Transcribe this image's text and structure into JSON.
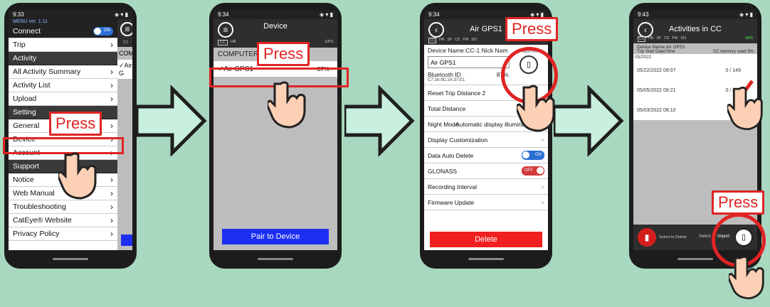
{
  "phone1": {
    "time": "9:33",
    "version": "MENU ver. 1.11",
    "connect_label": "Connect",
    "toggle_on": "ON",
    "items": [
      {
        "label": "Trip",
        "type": "item"
      },
      {
        "label": "Activity",
        "type": "section"
      },
      {
        "label": "All Activity Summary",
        "type": "item"
      },
      {
        "label": "Activity List",
        "type": "item"
      },
      {
        "label": "Upload",
        "type": "item"
      },
      {
        "label": "Setting",
        "type": "section"
      },
      {
        "label": "General",
        "type": "item"
      },
      {
        "label": "Device",
        "type": "item"
      },
      {
        "label": "Account",
        "type": "item"
      },
      {
        "label": "Support",
        "type": "section"
      },
      {
        "label": "Notice",
        "type": "item"
      },
      {
        "label": "Web Manual",
        "type": "item"
      },
      {
        "label": "Troubleshooting",
        "type": "item"
      },
      {
        "label": "CatEye® Website",
        "type": "item"
      },
      {
        "label": "Privacy Policy",
        "type": "item"
      }
    ],
    "side_comp": "COMP",
    "side_air": "✓Air G",
    "side_cc": "CC",
    "press": "Press"
  },
  "phone2": {
    "time": "9:34",
    "title": "Device",
    "computer_label": "COMPUTER",
    "device_name": "✓Air GPS1",
    "battery": "87%",
    "gps": "GPS",
    "pair_button": "Pair to Device",
    "press": "Press",
    "tabs": [
      "CC",
      "HR"
    ]
  },
  "phone3": {
    "time": "9:34",
    "title": "Air GPS1",
    "nickname_label": "Device Name:CC-1 Nick Nam",
    "name_value": "Air GPS1",
    "import_label": "Import from CC",
    "bluetooth_label": "Bluetooth ID",
    "bluetooth_id": "C7:3A:9C:2A:37:E1",
    "battery": "87%",
    "rows": [
      {
        "label": "Reset Trip Distance 2",
        "control": ""
      },
      {
        "label": "Total Distance",
        "control": ""
      },
      {
        "label": "Night Mode",
        "control": "Automatic display illumination"
      },
      {
        "label": "Display Customization",
        "control": ">"
      },
      {
        "label": "Data Auto Delete",
        "control": "ON"
      },
      {
        "label": "GLONASS",
        "control": "OFF"
      },
      {
        "label": "Recording Interval",
        "control": ">"
      },
      {
        "label": "Firmware Update",
        "control": ">"
      }
    ],
    "delete_button": "Delete",
    "press": "Press",
    "tabs": [
      "CC",
      "HR",
      "SP",
      "CD",
      "PW",
      "DI2"
    ],
    "gps": "GPS"
  },
  "phone4": {
    "time": "9:43",
    "title": "Activities in CC",
    "device_name": "Device Name:Air GPS1",
    "col_start": "Trip Start Date/Time",
    "col_mem": "CC memory used 5%",
    "month": "05/2022",
    "activities": [
      {
        "date": "05/22/2022 09:07",
        "size": "0 / 149"
      },
      {
        "date": "05/05/2022 09:21",
        "size": "0 / 255"
      },
      {
        "date": "05/03/2022 08:10",
        "size": "0 / 77"
      }
    ],
    "select_delete": "Select to Delete",
    "select_import": "Select t",
    "import_label": "Import",
    "press": "Press",
    "tabs": [
      "CC",
      "HR",
      "SP",
      "CD",
      "PW",
      "DI2"
    ],
    "gps": "GPS"
  }
}
